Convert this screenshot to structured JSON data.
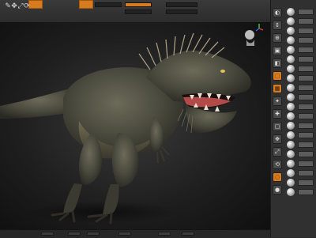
{
  "toolbar": {
    "tools": [
      {
        "name": "draw-tool-icon",
        "glyph": "✎",
        "label": ""
      },
      {
        "name": "move-tool-icon",
        "glyph": "✥",
        "label": ""
      },
      {
        "name": "scale-tool-icon",
        "glyph": "⤢",
        "label": ""
      },
      {
        "name": "rotate-tool-icon",
        "glyph": "⟳",
        "label": ""
      }
    ],
    "sliders": [
      {
        "name": "mrgb-slider",
        "label": "",
        "accent": false
      },
      {
        "name": "rgb-intensity-slider",
        "label": "",
        "accent": true
      },
      {
        "name": "z-intensity-slider",
        "label": "",
        "accent": false
      },
      {
        "name": "focal-shift-slider",
        "label": "",
        "accent": false
      },
      {
        "name": "draw-size-slider",
        "label": "",
        "accent": false
      }
    ]
  },
  "shelf": {
    "left_icons": [
      {
        "name": "bpr-icon",
        "glyph": "◐",
        "active": false
      },
      {
        "name": "scroll-icon",
        "glyph": "↕",
        "active": false
      },
      {
        "name": "zoom-icon",
        "glyph": "⊕",
        "active": false
      },
      {
        "name": "actual-icon",
        "glyph": "▣",
        "active": false
      },
      {
        "name": "aahalf-icon",
        "glyph": "◧",
        "active": false
      },
      {
        "name": "persp-icon",
        "glyph": "⬚",
        "active": true
      },
      {
        "name": "floor-icon",
        "glyph": "▦",
        "active": true
      },
      {
        "name": "local-icon",
        "glyph": "✦",
        "active": false
      },
      {
        "name": "xyz-icon",
        "glyph": "✚",
        "active": false
      },
      {
        "name": "frame-icon",
        "glyph": "▢",
        "active": false
      },
      {
        "name": "move-icon",
        "glyph": "✥",
        "active": false
      },
      {
        "name": "scale-icon",
        "glyph": "⤢",
        "active": false
      },
      {
        "name": "rotate-icon",
        "glyph": "⟲",
        "active": false
      },
      {
        "name": "transp-icon",
        "glyph": "◌",
        "active": true
      },
      {
        "name": "solo-icon",
        "glyph": "●",
        "active": false
      }
    ],
    "brush_rows": 20
  },
  "status": {
    "items": []
  },
  "colors": {
    "accent": "#d87a1e",
    "panel": "#303030",
    "viewport": "#1f1f1f"
  }
}
